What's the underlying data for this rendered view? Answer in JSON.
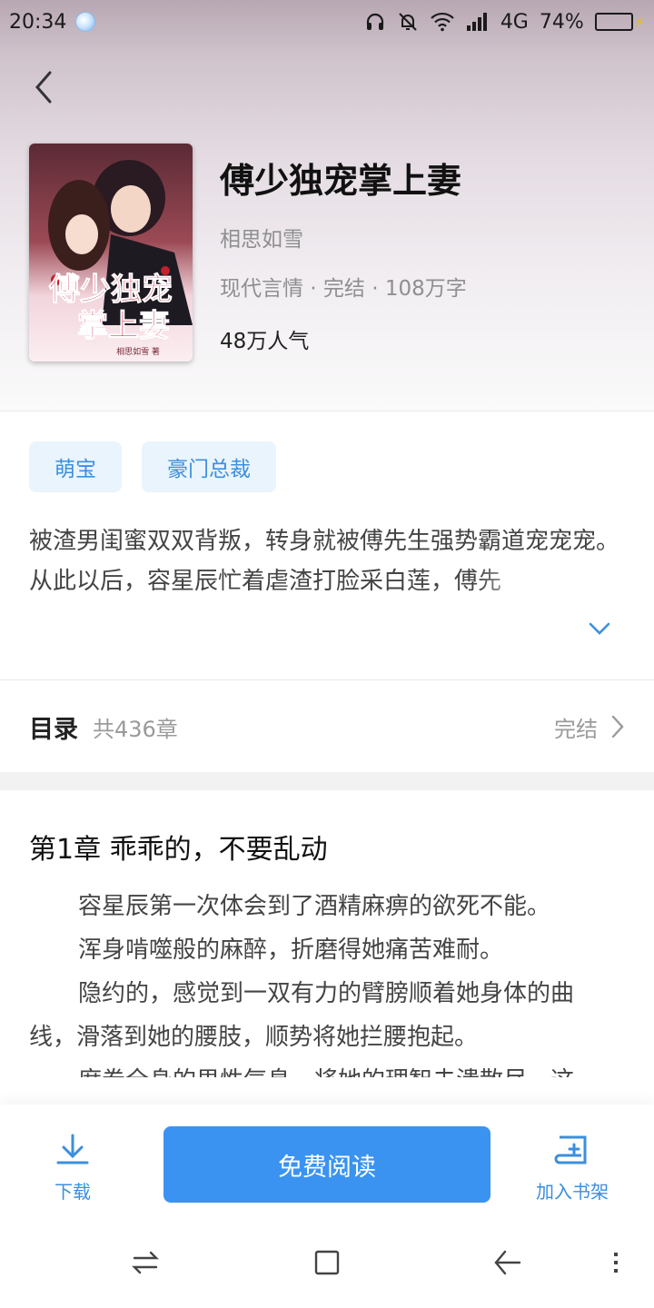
{
  "status_bar": {
    "time": "20:34",
    "network": "4G",
    "battery": "74%",
    "battery_level": 0.74
  },
  "book": {
    "title": "傅少独宠掌上妻",
    "author": "相思如雪",
    "meta": "现代言情 · 完结 · 108万字",
    "popularity": "48万人气",
    "cover": {
      "title_text": "傅少独宠掌上妻",
      "author_text": "相思如雪 著"
    }
  },
  "tags": [
    "萌宝",
    "豪门总裁"
  ],
  "synopsis": {
    "line1": "被渣男闺蜜双双背叛，转身就被傅先生强势霸道宠宠宠。",
    "line2": "从此以后，容星辰忙着虐渣打脸采白莲，傅先"
  },
  "catalog": {
    "label": "目录",
    "count": "共436章",
    "status": "完结"
  },
  "chapter": {
    "title": "第1章 乖乖的，不要乱动",
    "paragraphs": [
      "容星辰第一次体会到了酒精麻痹的欲死不能。",
      "浑身啃噬般的麻醉，折磨得她痛苦难耐。",
      "隐约的，感觉到一双有力的臂膀顺着她身体的曲线，滑落到她的腰肢，顺势将她拦腰抱起。",
      "席卷全身的男性气息，将她的理智击溃散尽，这"
    ]
  },
  "bottom_bar": {
    "download_label": "下载",
    "read_label": "免费阅读",
    "shelf_label": "加入书架"
  },
  "colors": {
    "accent": "#3a93f0",
    "tag_bg": "#eaf4fc",
    "tag_text": "#3c8fdd"
  },
  "icons": [
    "weather-icon",
    "headphone-icon",
    "mute-icon",
    "wifi-icon",
    "signal-icon",
    "battery-icon",
    "back-icon",
    "chevron-down-icon",
    "chevron-right-icon",
    "download-icon",
    "bookshelf-add-icon",
    "switch-icon",
    "home-square-icon",
    "nav-back-icon",
    "menu-icon"
  ]
}
